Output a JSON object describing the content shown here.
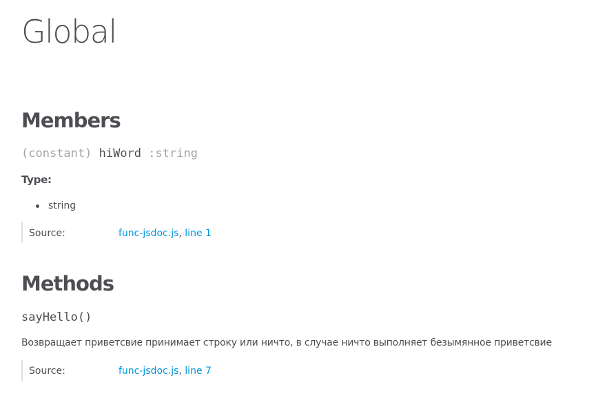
{
  "page": {
    "title": "Global"
  },
  "members": {
    "heading": "Members",
    "items": [
      {
        "attribs": "(constant)",
        "name": "hiWord",
        "type_signature": ":string",
        "type_heading": "Type:",
        "types": [
          "string"
        ],
        "source_label": "Source:",
        "source_file": "func-jsdoc.js",
        "source_separator": ",",
        "source_line": "line 1"
      }
    ]
  },
  "methods": {
    "heading": "Methods",
    "items": [
      {
        "name": "sayHello()",
        "description": "Возвращает приветсвие принимает строку или ничто, в случае ничто выполняет безымянное приветсвие",
        "source_label": "Source:",
        "source_file": "func-jsdoc.js",
        "source_separator": ",",
        "source_line": "line 7"
      }
    ]
  }
}
